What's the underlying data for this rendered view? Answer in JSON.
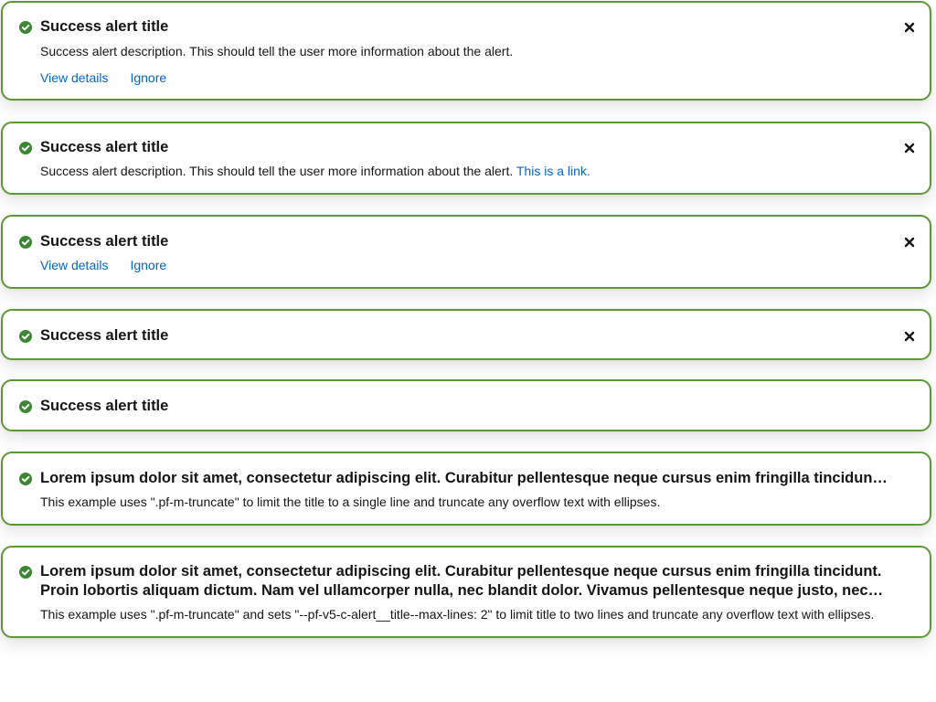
{
  "alerts": [
    {
      "title": "Success alert title",
      "description": "Success alert description. This should tell the user more information about the alert.",
      "actions": [
        "View details",
        "Ignore"
      ],
      "closable": true
    },
    {
      "title": "Success alert title",
      "description": "Success alert description. This should tell the user more information about the alert.",
      "link": "This is a link.",
      "closable": true
    },
    {
      "title": "Success alert title",
      "actions": [
        "View details",
        "Ignore"
      ],
      "closable": true
    },
    {
      "title": "Success alert title",
      "closable": true
    },
    {
      "title": "Success alert title",
      "closable": false
    },
    {
      "title": "Lorem ipsum dolor sit amet, consectetur adipiscing elit. Curabitur pellentesque neque cursus enim fringilla tincidunt. Proin lobortis aliquam dictum. Nam vel ullamcorper nulla, nec blandit dolor. Vivamus pellentesque neque justo, nec accumsan nulla rhoncus id. Suspendisse mollis, tortor quis faucibus volutpat, sem leo fringilla turpis, ac lacinia augue metus in nulla.",
      "description": "This example uses \".pf-m-truncate\" to limit the title to a single line and truncate any overflow text with ellipses.",
      "closable": false
    },
    {
      "title": "Lorem ipsum dolor sit amet, consectetur adipiscing elit. Curabitur pellentesque neque cursus enim fringilla tincidunt. Proin lobortis aliquam dictum. Nam vel ullamcorper nulla, nec blandit dolor. Vivamus pellentesque neque justo, nec accumsan nulla rhoncus id. Suspendisse mollis, tortor quis faucibus volutpat, sem leo fringilla turpis, ac lacinia augue metus in nulla.",
      "description": "This example uses \".pf-m-truncate\" and sets \"--pf-v5-c-alert__title--max-lines: 2\" to limit title to two lines and truncate any overflow text with ellipses.",
      "closable": false
    }
  ],
  "colors": {
    "border": "#5e9835",
    "icon": "#3e8635",
    "link": "#0066cc",
    "text": "#151515"
  },
  "icons": {
    "status": "check-circle-icon",
    "close": "close-icon"
  }
}
